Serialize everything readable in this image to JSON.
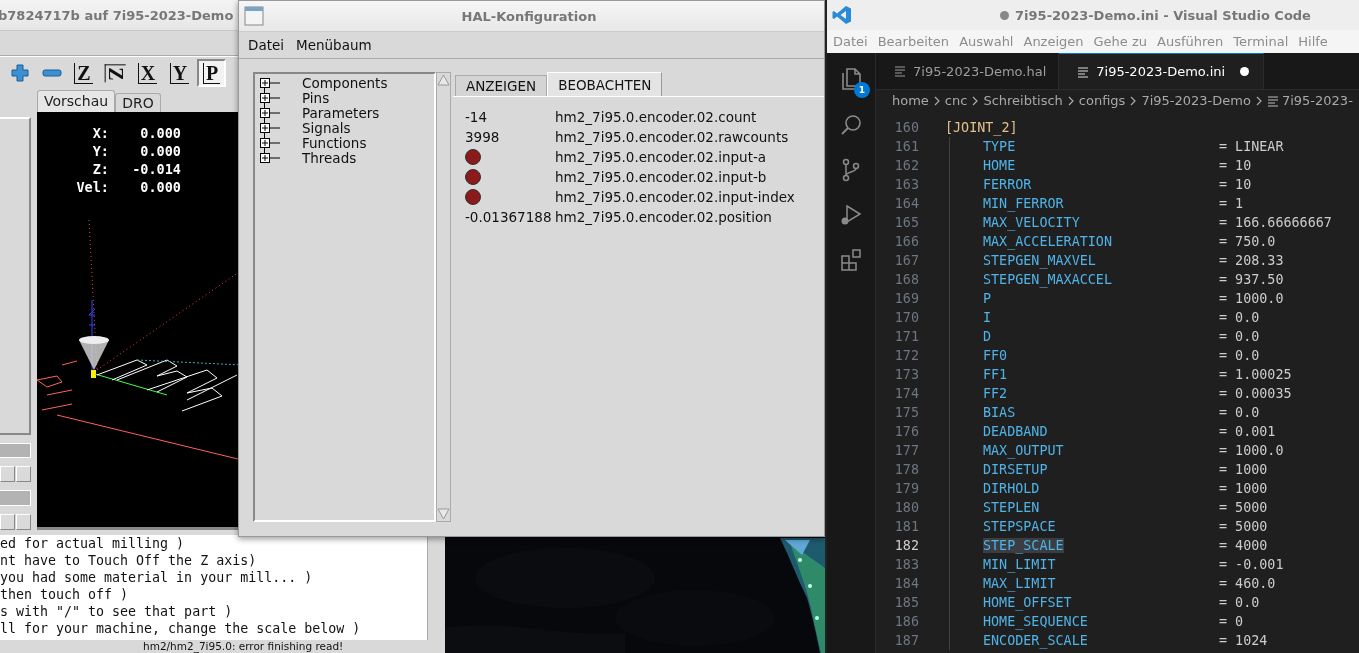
{
  "axis_window": {
    "title": "b7824717b auf  7i95-2023-Demo",
    "toolbar": [
      {
        "kind": "plus",
        "selected": false
      },
      {
        "kind": "minus",
        "selected": false
      },
      {
        "kind": "view",
        "label": "Z",
        "rotated": false,
        "selected": false
      },
      {
        "kind": "view",
        "label": "Z",
        "rotated": true,
        "selected": false
      },
      {
        "kind": "view",
        "label": "X",
        "rotated": false,
        "selected": false
      },
      {
        "kind": "view",
        "label": "Y",
        "rotated": false,
        "selected": false
      },
      {
        "kind": "view",
        "label": "P",
        "rotated": false,
        "selected": true
      }
    ],
    "tabs": [
      {
        "label": "Vorschau",
        "selected": true
      },
      {
        "label": "DRO",
        "selected": false
      }
    ],
    "dro": [
      {
        "axis": "X:",
        "value": "0.000"
      },
      {
        "axis": "Y:",
        "value": "0.000"
      },
      {
        "axis": "Z:",
        "value": "-0.014"
      },
      {
        "axis": "Vel:",
        "value": "0.000"
      }
    ],
    "gcode_lines": [
      "ed for actual milling )",
      "nt have to Touch Off the Z axis)",
      "you had some material in your mill... )",
      "then touch off )",
      "s with \"/\" to see that part )",
      "ll for your machine, change the scale below )"
    ],
    "status": "hm2/hm2_7i95.0: error finishing read!"
  },
  "hal_window": {
    "title": "HAL-Konfiguration",
    "menu": [
      "Datei",
      "Menübaum"
    ],
    "tree": [
      {
        "label": "Components",
        "expanded": false
      },
      {
        "label": "Pins",
        "expanded": false
      },
      {
        "label": "Parameters",
        "expanded": false
      },
      {
        "label": "Signals",
        "expanded": false
      },
      {
        "label": "Functions",
        "expanded": false
      },
      {
        "label": "Threads",
        "expanded": false
      }
    ],
    "tabs": [
      {
        "label": "ANZEIGEN",
        "selected": false
      },
      {
        "label": "BEOBACHTEN",
        "selected": true
      }
    ],
    "watch": [
      {
        "kind": "value",
        "value": "-14",
        "name": "hm2_7i95.0.encoder.02.count"
      },
      {
        "kind": "value",
        "value": "3998",
        "name": "hm2_7i95.0.encoder.02.rawcounts"
      },
      {
        "kind": "bit",
        "on": false,
        "name": "hm2_7i95.0.encoder.02.input-a"
      },
      {
        "kind": "bit",
        "on": false,
        "name": "hm2_7i95.0.encoder.02.input-b"
      },
      {
        "kind": "bit",
        "on": false,
        "name": "hm2_7i95.0.encoder.02.input-index"
      },
      {
        "kind": "value",
        "value": "-0.01367188",
        "name": "hm2_7i95.0.encoder.02.position"
      }
    ]
  },
  "vscode": {
    "title": "7i95-2023-Demo.ini - Visual Studio Code",
    "unsaved": true,
    "menu": [
      "Datei",
      "Bearbeiten",
      "Auswahl",
      "Anzeigen",
      "Gehe zu",
      "Ausführen",
      "Terminal",
      "Hilfe"
    ],
    "explorer_badge": "1",
    "tabs": [
      {
        "label": "7i95-2023-Demo.hal",
        "selected": false,
        "modified": false
      },
      {
        "label": "7i95-2023-Demo.ini",
        "selected": true,
        "modified": true
      }
    ],
    "breadcrumb": [
      "home",
      "cnc",
      "Schreibtisch",
      "configs",
      "7i95-2023-Demo",
      "7i95-2023-"
    ],
    "lines": [
      {
        "number": "160",
        "kind": "section",
        "text": "[JOINT_2]",
        "selected": false
      },
      {
        "number": "161",
        "kind": "entry",
        "key": "TYPE",
        "value": "= LINEAR",
        "selected": false
      },
      {
        "number": "162",
        "kind": "entry",
        "key": "HOME",
        "value": "= 10",
        "selected": false
      },
      {
        "number": "163",
        "kind": "entry",
        "key": "FERROR",
        "value": "= 10",
        "selected": false
      },
      {
        "number": "164",
        "kind": "entry",
        "key": "MIN_FERROR",
        "value": "= 1",
        "selected": false
      },
      {
        "number": "165",
        "kind": "entry",
        "key": "MAX_VELOCITY",
        "value": "= 166.66666667",
        "selected": false
      },
      {
        "number": "166",
        "kind": "entry",
        "key": "MAX_ACCELERATION",
        "value": "= 750.0",
        "selected": false
      },
      {
        "number": "167",
        "kind": "entry",
        "key": "STEPGEN_MAXVEL",
        "value": "= 208.33",
        "selected": false
      },
      {
        "number": "168",
        "kind": "entry",
        "key": "STEPGEN_MAXACCEL",
        "value": "= 937.50",
        "selected": false
      },
      {
        "number": "169",
        "kind": "entry",
        "key": "P",
        "value": "= 1000.0",
        "selected": false
      },
      {
        "number": "170",
        "kind": "entry",
        "key": "I",
        "value": "= 0.0",
        "selected": false
      },
      {
        "number": "171",
        "kind": "entry",
        "key": "D",
        "value": "= 0.0",
        "selected": false
      },
      {
        "number": "172",
        "kind": "entry",
        "key": "FF0",
        "value": "= 0.0",
        "selected": false
      },
      {
        "number": "173",
        "kind": "entry",
        "key": "FF1",
        "value": "= 1.00025",
        "selected": false
      },
      {
        "number": "174",
        "kind": "entry",
        "key": "FF2",
        "value": "= 0.00035",
        "selected": false
      },
      {
        "number": "175",
        "kind": "entry",
        "key": "BIAS",
        "value": "= 0.0",
        "selected": false
      },
      {
        "number": "176",
        "kind": "entry",
        "key": "DEADBAND",
        "value": "= 0.001",
        "selected": false
      },
      {
        "number": "177",
        "kind": "entry",
        "key": "MAX_OUTPUT",
        "value": "= 1000.0",
        "selected": false
      },
      {
        "number": "178",
        "kind": "entry",
        "key": "DIRSETUP",
        "value": "= 1000",
        "selected": false
      },
      {
        "number": "179",
        "kind": "entry",
        "key": "DIRHOLD",
        "value": "= 1000",
        "selected": false
      },
      {
        "number": "180",
        "kind": "entry",
        "key": "STEPLEN",
        "value": "= 5000",
        "selected": false
      },
      {
        "number": "181",
        "kind": "entry",
        "key": "STEPSPACE",
        "value": "= 5000",
        "selected": false
      },
      {
        "number": "182",
        "kind": "entry",
        "key": "STEP_SCALE",
        "value": "= 4000",
        "selected": true
      },
      {
        "number": "183",
        "kind": "entry",
        "key": "MIN_LIMIT",
        "value": "= -0.001",
        "selected": false
      },
      {
        "number": "184",
        "kind": "entry",
        "key": "MAX_LIMIT",
        "value": "= 460.0",
        "selected": false
      },
      {
        "number": "185",
        "kind": "entry",
        "key": "HOME_OFFSET",
        "value": "= 0.0",
        "selected": false
      },
      {
        "number": "186",
        "kind": "entry",
        "key": "HOME_SEQUENCE",
        "value": "= 0",
        "selected": false
      },
      {
        "number": "187",
        "kind": "entry",
        "key": "ENCODER_SCALE",
        "value": "= 1024",
        "selected": false
      }
    ]
  }
}
